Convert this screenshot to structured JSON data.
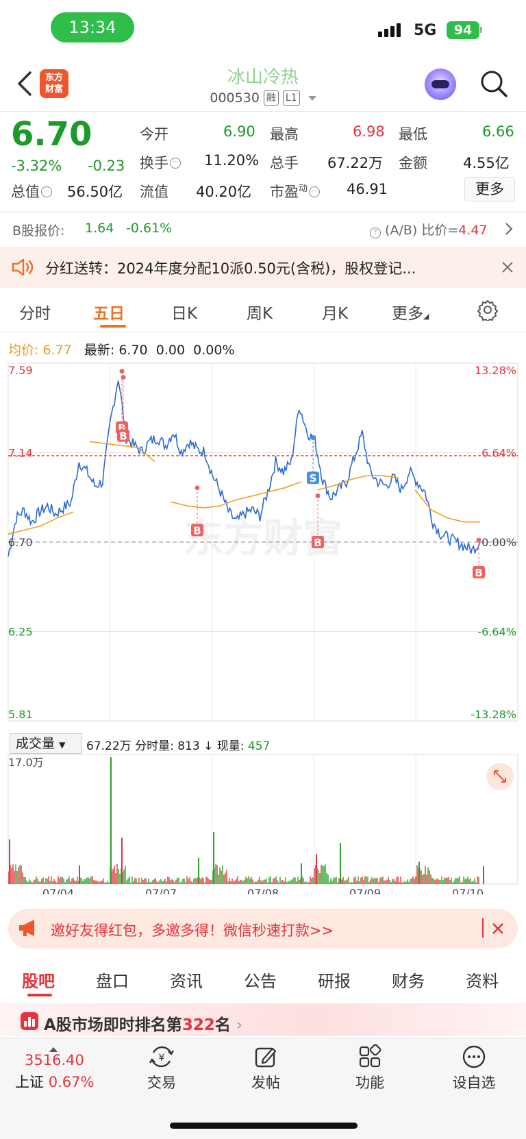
{
  "status_bar": {
    "time": "13:34",
    "network": "5G",
    "battery": "94"
  },
  "header": {
    "logo_text": "东方\n财富",
    "stock_name": "冰山冷热",
    "stock_code": "000530",
    "tag_margin": "融",
    "tag_level": "L1"
  },
  "quote": {
    "price": "6.70",
    "change_pct": "-3.32%",
    "change": "-0.23",
    "open_label": "今开",
    "open": "6.90",
    "high_label": "最高",
    "high": "6.98",
    "low_label": "最低",
    "low": "6.66",
    "turnover_label": "换手",
    "turnover": "11.20%",
    "volume_label": "总手",
    "volume": "67.22万",
    "amount_label": "金额",
    "amount": "4.55亿",
    "mktcap_label": "总值",
    "mktcap": "56.50亿",
    "float_label": "流值",
    "float": "40.20亿",
    "pe_label": "市盈",
    "pe_sup": "动",
    "pe": "46.91",
    "more_label": "更多"
  },
  "bshare": {
    "label": "B股报价:",
    "price": "1.64",
    "change": "-0.61%",
    "ratio_label": "(A/B) 比价=",
    "ratio": "4.47"
  },
  "notice": {
    "text": "分红送转：2024年度分配10派0.50元(含税)，股权登记..."
  },
  "chart_tabs": [
    "分时",
    "五日",
    "日K",
    "周K",
    "月K",
    "更多"
  ],
  "avg_row": {
    "avg_label": "均价:",
    "avg": "6.77",
    "latest_label": "最新:",
    "latest": "6.70",
    "chg": "0.00",
    "pct": "0.00%"
  },
  "chart_data": {
    "type": "line",
    "x": [
      "07/04",
      "07/07",
      "07/08",
      "07/09",
      "07/10"
    ],
    "y_ticks_left": [
      "7.59",
      "7.14",
      "6.70",
      "6.25",
      "5.81"
    ],
    "y_ticks_right": [
      "13.28%",
      "6.64%",
      "0.00%",
      "-6.64%",
      "-13.28%"
    ],
    "ylim": [
      5.81,
      7.59
    ],
    "watermark": "东方财富",
    "reference_price": 6.7,
    "highlight_price": 7.13,
    "series": [
      {
        "values": [
          6.63,
          6.82,
          6.86,
          6.8,
          6.85,
          6.88,
          6.84,
          6.87,
          6.9,
          7.1,
          7.05,
          6.98,
          7.0,
          7.3,
          7.52,
          7.22,
          7.18,
          7.15,
          7.2,
          7.22,
          7.18,
          7.25,
          7.15,
          7.2,
          7.16,
          7.15,
          7.03,
          6.95,
          6.85,
          6.8,
          6.84,
          6.86,
          6.83,
          6.95,
          7.1,
          7.05,
          7.1,
          7.38,
          7.25,
          7.2,
          7.01,
          6.92,
          6.96,
          7.0,
          7.12,
          7.24,
          7.05,
          7.0,
          6.98,
          7.02,
          6.96,
          7.05,
          7.0,
          6.95,
          6.8,
          6.74,
          6.72,
          6.7,
          6.68,
          6.66,
          6.7
        ]
      },
      {
        "values": [
          6.74,
          6.76,
          6.78,
          6.82,
          6.85,
          7.2,
          7.19,
          7.18,
          7.17,
          7.1,
          6.9,
          6.88,
          6.87,
          6.88,
          6.91,
          6.93,
          6.95,
          6.97,
          7.0,
          6.96,
          6.98,
          7.01,
          7.03,
          7.03,
          7.02,
          6.96,
          6.86,
          6.82,
          6.8,
          6.8
        ]
      }
    ],
    "trade_markers": [
      "B",
      "B",
      "B",
      "S",
      "B",
      "B"
    ],
    "volume": {
      "label": "成交量",
      "total": "67.22万",
      "tick_label": "分时量:",
      "tick_volume": "813",
      "now_label": "现量:",
      "now_volume": "457",
      "ymax_label": "17.0万",
      "spikes": [
        6.0,
        2.5,
        9.5,
        17.0,
        6.2,
        3.5,
        7.0,
        2.8,
        4.0,
        5.5,
        3.0,
        2.4
      ]
    }
  },
  "invite": {
    "text": "邀好友得红包，多邀多得！微信秒速打款>>"
  },
  "bottom_tabs": [
    "股吧",
    "盘口",
    "资讯",
    "公告",
    "研报",
    "财务",
    "资料"
  ],
  "rank": {
    "prefix": "A股市场即时排名第",
    "value": "322",
    "suffix": "名"
  },
  "tabbar": {
    "index_value": "3516.40",
    "index_name": "上证",
    "index_pct": "0.67%",
    "items": [
      {
        "label": "交易",
        "icon": "yuan-exchange-icon"
      },
      {
        "label": "发帖",
        "icon": "edit-post-icon"
      },
      {
        "label": "功能",
        "icon": "function-grid-icon"
      },
      {
        "label": "设自选",
        "icon": "more-dots-icon"
      }
    ]
  }
}
